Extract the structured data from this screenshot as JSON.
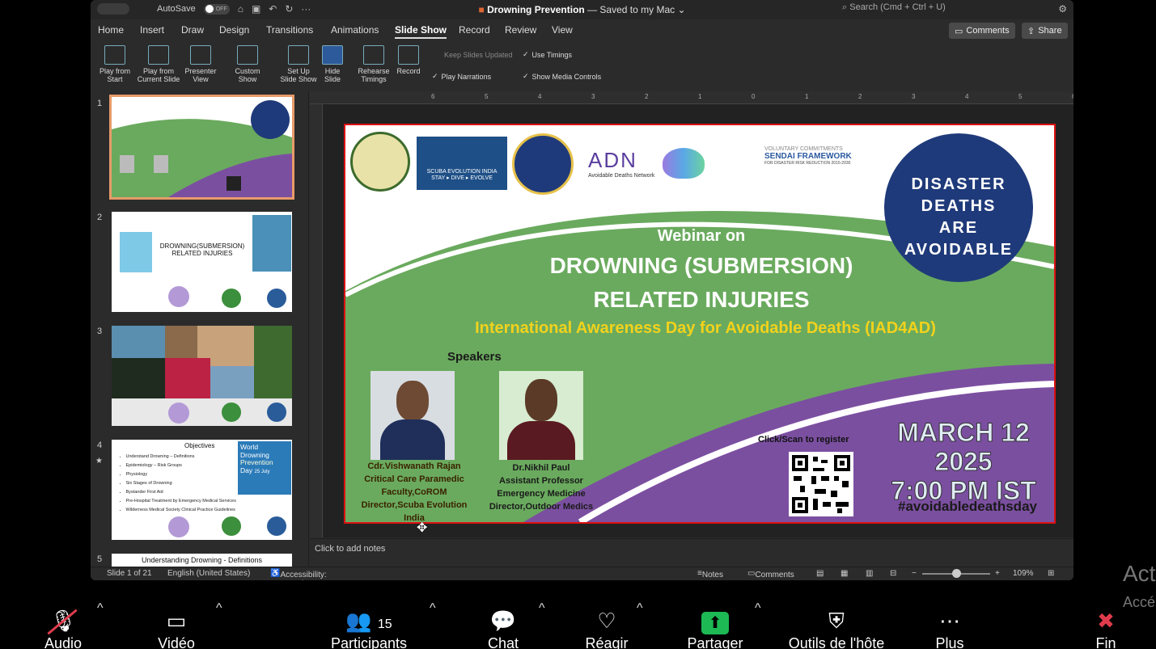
{
  "titlebar": {
    "autosave": "AutoSave",
    "toggle": "OFF",
    "doc_title": "Drowning Prevention",
    "doc_status": " — Saved to my Mac",
    "search_placeholder": "Search (Cmd + Ctrl + U)"
  },
  "tabs": [
    "Home",
    "Insert",
    "Draw",
    "Design",
    "Transitions",
    "Animations",
    "Slide Show",
    "Record",
    "Review",
    "View"
  ],
  "active_tab": "Slide Show",
  "buttons": {
    "comments": "Comments",
    "share": "Share"
  },
  "ribbon": {
    "play_from_start": [
      "Play from",
      "Start"
    ],
    "play_from_current": [
      "Play from",
      "Current Slide"
    ],
    "presenter_view": [
      "Presenter",
      "View"
    ],
    "custom_show": [
      "Custom",
      "Show"
    ],
    "setup_show": [
      "Set Up",
      "Slide Show"
    ],
    "hide_slide": [
      "Hide",
      "Slide"
    ],
    "rehearse": [
      "Rehearse",
      "Timings"
    ],
    "record": "Record",
    "keep_updated": "Keep Slides Updated",
    "use_timings": "Use Timings",
    "play_narrations": "Play Narrations",
    "show_media_controls": "Show Media Controls"
  },
  "ruler_marks": [
    "6",
    "5",
    "4",
    "3",
    "2",
    "1",
    "0",
    "1",
    "2",
    "3",
    "4",
    "5",
    "6"
  ],
  "thumbnails": [
    {
      "num": "1"
    },
    {
      "num": "2",
      "title": "DROWNING(SUBMERSION)\nRELATED INJURIES"
    },
    {
      "num": "3"
    },
    {
      "num": "4",
      "title": "Objectives",
      "bullets": [
        "Understand Drowning – Definitions",
        "Epidemiology – Risk Groups",
        "Physiology",
        "Six Stages of Drowning",
        "Bystander First Aid",
        "Pre-Hospital Treatment by Emergency Medical Services",
        "Wilderness Medical Society Clinical Practice Guidelines"
      ],
      "badge": [
        "World",
        "Drowning",
        "Prevention",
        "Day",
        "25 July"
      ]
    },
    {
      "num": "5",
      "title": "Understanding Drowning - Definitions"
    }
  ],
  "slide": {
    "webinar_on": "Webinar on",
    "title1": "DROWNING (SUBMERSION)",
    "title2": "RELATED INJURIES",
    "subtitle": "International Awareness Day for Avoidable Deaths (IAD4AD)",
    "speakers_label": "Speakers",
    "speaker1": [
      "Cdr.Vishwanath Rajan",
      "Critical Care Paramedic",
      "Faculty,CoROM",
      "Director,Scuba Evolution",
      "India"
    ],
    "speaker2": [
      "Dr.Nikhil Paul",
      "Assistant Professor",
      "Emergency Medicine",
      "Director,Outdoor Medics"
    ],
    "scan": "Click/Scan to register",
    "date": "MARCH 12 2025",
    "time": "7:00 PM IST",
    "hashtag": "#avoidabledeathsday",
    "badge": [
      "DISASTER",
      "DEATHS",
      "ARE",
      "AVOIDABLE"
    ],
    "scuba_line": "SCUBA EVOLUTION INDIA",
    "scuba_sub": "STAY ▸ DIVE ▸ EVOLVE",
    "adn": "Avoidable Deaths Network",
    "vc": "VOLUNTARY COMMITMENTS",
    "sendai": "SENDAI FRAMEWORK",
    "sendai_sub": "FOR DISASTER RISK REDUCTION 2015-2030"
  },
  "notes_placeholder": "Click to add notes",
  "status": {
    "slide": "Slide 1 of 21",
    "language": "English (United States)",
    "accessibility": "Accessibility: Investigate",
    "notes": "Notes",
    "comments": "Comments",
    "zoom": "109%"
  },
  "zoom_bar": {
    "audio": "Audio",
    "video": "Vidéo",
    "participants": "Participants",
    "participants_count": "15",
    "chat": "Chat",
    "react": "Réagir",
    "share": "Partager",
    "host_tools": "Outils de l'hôte",
    "more": "Plus",
    "end": "Fin"
  },
  "watermark": [
    "Act",
    "Accé"
  ],
  "colors": {
    "green": "#6aaa5e",
    "purple": "#7b4fa0",
    "navy": "#1f3a7a",
    "yellow": "#f2d21c",
    "share_green": "#1db954",
    "end_red": "#e03b4c"
  }
}
